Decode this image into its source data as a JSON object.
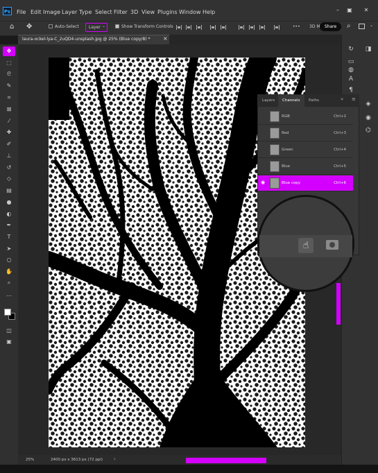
{
  "app": {
    "logo": "Ps"
  },
  "menu": [
    "File",
    "Edit",
    "Image",
    "Layer",
    "Type",
    "Select",
    "Filter",
    "3D",
    "View",
    "Plugins",
    "Window",
    "Help"
  ],
  "window_controls": {
    "minimize": "–",
    "restore": "▣",
    "close": "✕"
  },
  "options": {
    "auto_select": "Auto-Select",
    "layer_dropdown": "Layer",
    "show_transform": "Show Transform Controls",
    "more": "•••",
    "mode_3d": "3D M",
    "share": "Share"
  },
  "document_tab": {
    "label": "laura-ockel-lya-C_2uQD4-unsplash.jpg @ 25% (Blue copy/8) *",
    "close": "×"
  },
  "channels_panel": {
    "tabs": [
      "Layers",
      "Channels",
      "Paths"
    ],
    "active_tab": "Channels",
    "channels": [
      {
        "name": "RGB",
        "shortcut": "Ctrl+2"
      },
      {
        "name": "Red",
        "shortcut": "Ctrl+3"
      },
      {
        "name": "Green",
        "shortcut": "Ctrl+4"
      },
      {
        "name": "Blue",
        "shortcut": "Ctrl+5"
      },
      {
        "name": "Blue copy",
        "shortcut": "Ctrl+6"
      }
    ],
    "selected_channel": "Blue copy",
    "accent_color": "#d400ff"
  },
  "status": {
    "zoom": "25%",
    "doc_size": "2400 px x 3613 px (72 ppi)"
  },
  "icons": {
    "tools": [
      "move-icon",
      "marquee-icon",
      "lasso-icon",
      "quick-select-icon",
      "crop-icon",
      "frame-icon",
      "eyedropper-icon",
      "healing-icon",
      "brush-icon",
      "stamp-icon",
      "history-brush-icon",
      "eraser-icon",
      "gradient-icon",
      "blur-icon",
      "dodge-icon",
      "pen-icon",
      "type-icon",
      "path-select-icon",
      "shape-icon",
      "hand-icon",
      "zoom-icon",
      "more-tools-icon"
    ],
    "right_strip": [
      "history-icon",
      "comment-icon",
      "adjust-icon",
      "character-icon",
      "paragraph-icon",
      "layers-icon",
      "channels-icon",
      "paths-icon"
    ]
  }
}
